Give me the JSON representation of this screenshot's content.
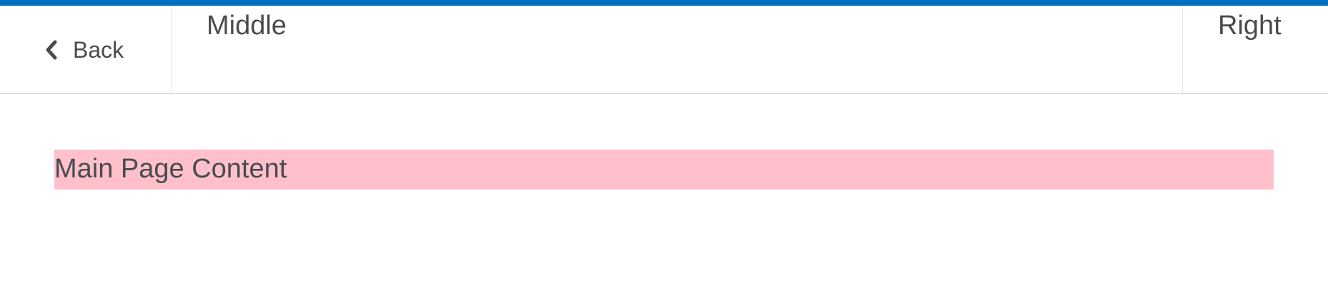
{
  "colors": {
    "accent_bar": "#006fbf",
    "text": "#494c4e",
    "divider": "#cdd5dc",
    "content_background": "#ffc0cb"
  },
  "header": {
    "back": {
      "label": "Back",
      "icon": "chevron-left-icon"
    },
    "middle_label": "Middle",
    "right_label": "Right"
  },
  "main": {
    "content_text": "Main Page Content"
  }
}
